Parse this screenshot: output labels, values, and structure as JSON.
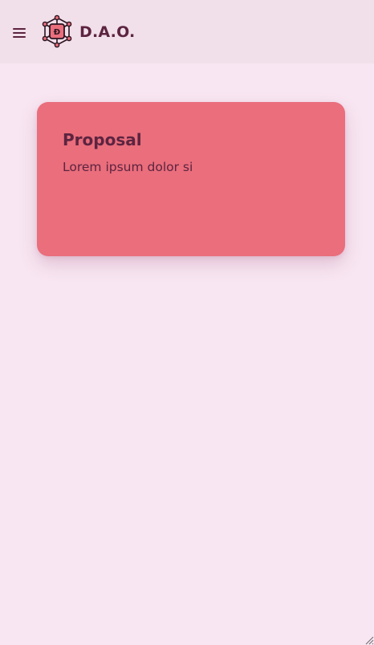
{
  "header": {
    "app_title": "D.A.O.",
    "menu_icon": "hamburger-menu-icon",
    "logo_icon": "dao-network-logo-icon",
    "logo_letter": "Đ"
  },
  "proposal": {
    "title": "Proposal",
    "body": "Lorem ipsum dolor si"
  },
  "colors": {
    "page_background": "#f8e6f2",
    "header_background": "#f1dfea",
    "card_background": "#ea6e7c",
    "text": "#5c2440"
  }
}
